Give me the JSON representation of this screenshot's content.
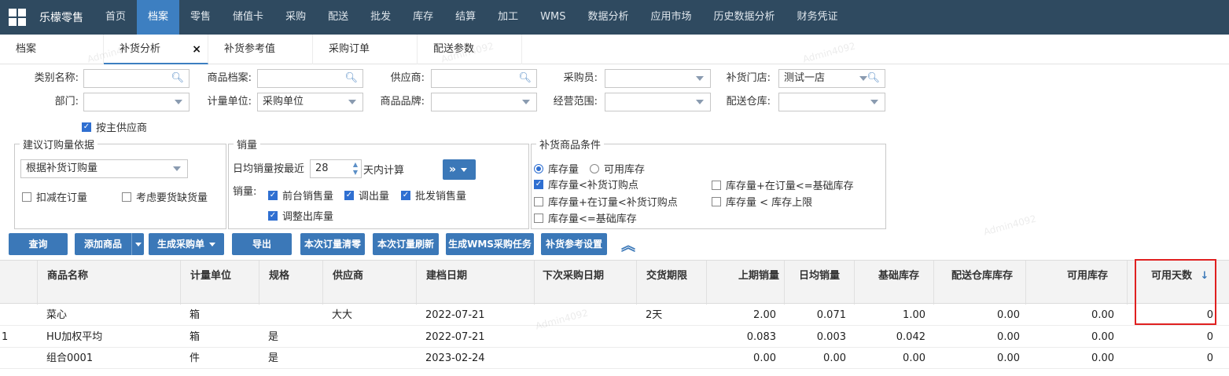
{
  "nav": {
    "brand": "乐檬零售",
    "items": [
      "首页",
      "档案",
      "零售",
      "储值卡",
      "采购",
      "配送",
      "批发",
      "库存",
      "结算",
      "加工",
      "WMS",
      "数据分析",
      "应用市场",
      "历史数据分析",
      "财务凭证"
    ],
    "active_index": 1
  },
  "tabs": [
    {
      "label": "档案"
    },
    {
      "label": "补货分析",
      "close": "×"
    },
    {
      "label": "补货参考值"
    },
    {
      "label": "采购订单"
    },
    {
      "label": "配送参数"
    }
  ],
  "filters": {
    "category_label": "类别名称:",
    "product_label": "商品档案:",
    "supplier_label": "供应商:",
    "buyer_label": "采购员:",
    "store_label": "补货门店:",
    "store_value": "测试一店",
    "dept_label": "部门:",
    "unit_label": "计量单位:",
    "unit_value": "采购单位",
    "brand_label": "商品品牌:",
    "scope_label": "经营范围:",
    "warehouse_label": "配送仓库:",
    "main_supplier": "按主供应商"
  },
  "order_basis": {
    "legend": "建议订购量依据",
    "select_value": "根据补货订购量",
    "deduct": "扣减在订量",
    "consider": "考虑要货缺货量"
  },
  "sales": {
    "legend": "销量",
    "days_prefix": "日均销量按最近",
    "days_value": "28",
    "days_suffix": "天内计算",
    "more": "»",
    "qty_label": "销量:",
    "opt_front": "前台销售量",
    "opt_out": "调出量",
    "opt_wholesale": "批发销售量",
    "opt_adjust": "调整出库量"
  },
  "conditions": {
    "legend": "补货商品条件",
    "radio_stock": "库存量",
    "radio_avail": "可用库存",
    "c1": "库存量<补货订购点",
    "c2": "库存量+在订量<补货订购点",
    "c3": "库存量<=基础库存",
    "c4": "库存量+在订量<=基础库存",
    "c5": "库存量 < 库存上限"
  },
  "buttons": {
    "query": "查询",
    "add": "添加商品",
    "gen_po": "生成采购单",
    "export": "导出",
    "clear": "本次订量清零",
    "refresh": "本次订量刷新",
    "wms": "生成WMS采购任务",
    "settings": "补货参考设置",
    "collapse": "︽"
  },
  "table": {
    "headers": {
      "name": "商品名称",
      "unit": "计量单位",
      "spec": "规格",
      "supplier": "供应商",
      "created": "建档日期",
      "next": "下次采购日期",
      "lead": "交货期限",
      "last_sales": "上期销量",
      "avg_sales": "日均销量",
      "base_stock": "基础库存",
      "wh_stock": "配送仓库库存",
      "avail_stock": "可用库存",
      "avail_days": "可用天数",
      "sort_icon": "↓"
    },
    "rows": [
      {
        "idx": "",
        "name": "菜心",
        "unit": "箱",
        "spec": "",
        "supplier": "大大",
        "created": "2022-07-21",
        "next": "",
        "lead": "2天",
        "last_sales": "2.00",
        "avg_sales": "0.071",
        "base_stock": "1.00",
        "wh_stock": "0.00",
        "avail_stock": "0.00",
        "avail_days": "0"
      },
      {
        "idx": "1",
        "name": "HU加权平均",
        "unit": "箱",
        "spec": "是",
        "supplier": "",
        "created": "2022-07-21",
        "next": "",
        "lead": "",
        "last_sales": "0.083",
        "avg_sales": "0.003",
        "base_stock": "0.042",
        "wh_stock": "0.00",
        "avail_stock": "0.00",
        "avail_days": "0"
      },
      {
        "idx": "",
        "name": "组合0001",
        "unit": "件",
        "spec": "是",
        "supplier": "",
        "created": "2023-02-24",
        "next": "",
        "lead": "",
        "last_sales": "0.00",
        "avg_sales": "0.00",
        "base_stock": "0.00",
        "wh_stock": "0.00",
        "avail_stock": "0.00",
        "avail_days": "0"
      }
    ]
  },
  "watermark": "Admin4092"
}
